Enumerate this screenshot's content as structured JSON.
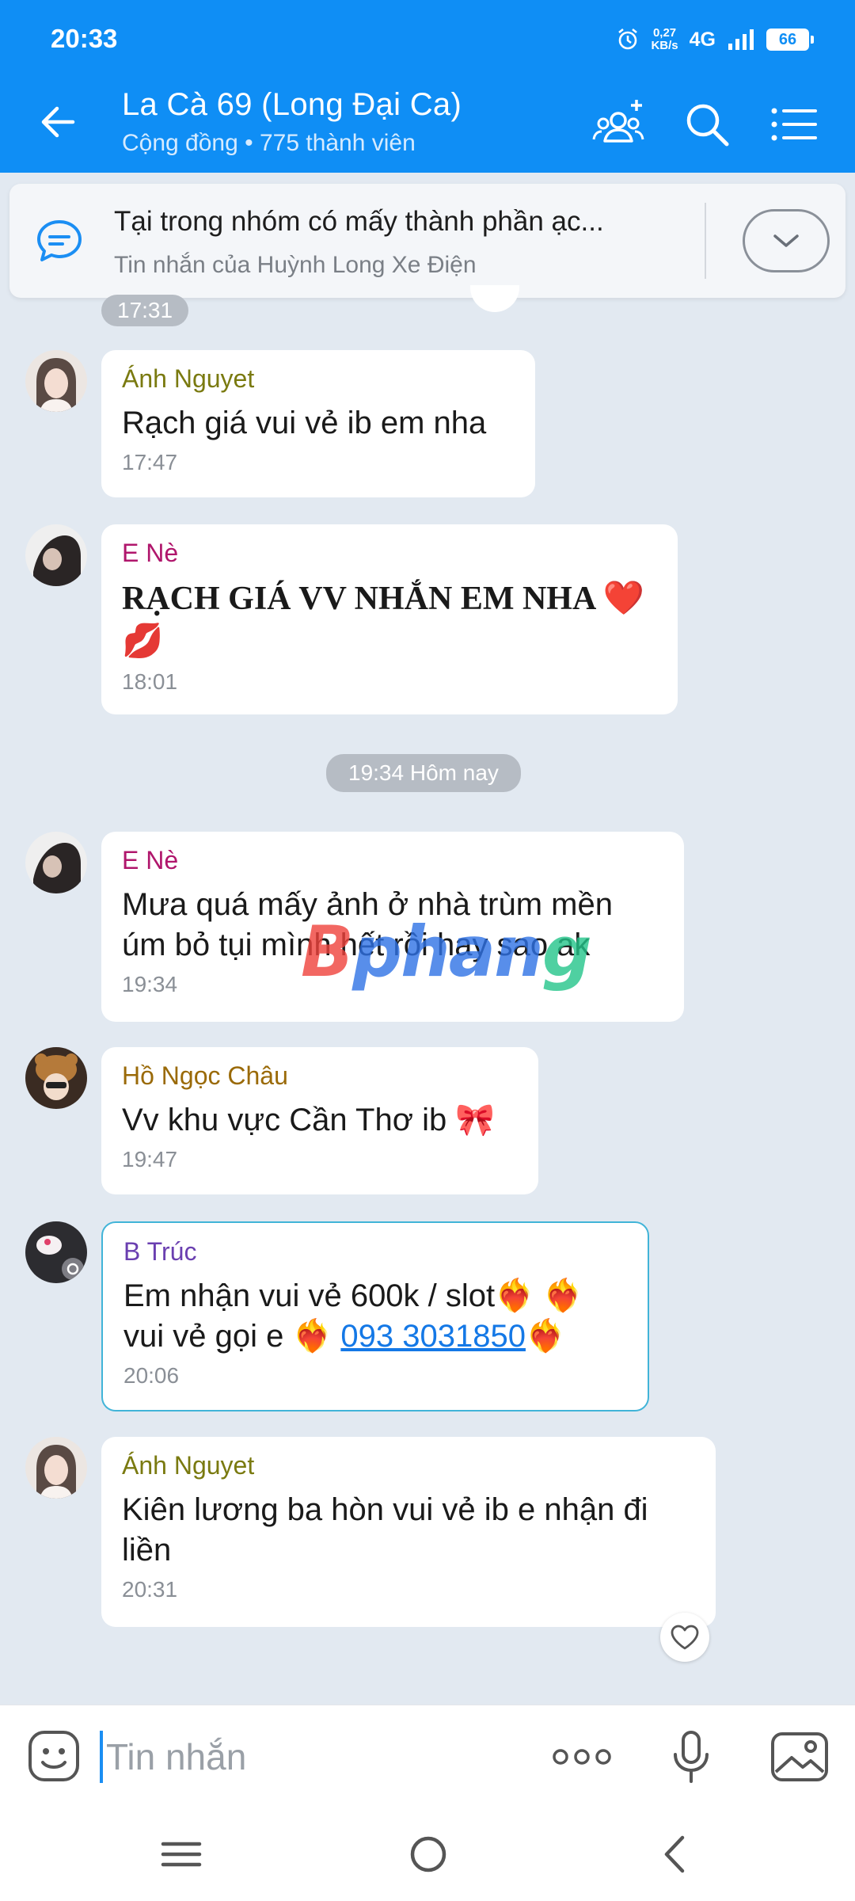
{
  "status": {
    "time": "20:33",
    "speed_top": "0,27",
    "speed_bottom": "KB/s",
    "network": "4G",
    "battery": "66"
  },
  "header": {
    "title": "La Cà 69 (Long Đại Ca)",
    "subtitle": "Cộng đồng • 775 thành viên"
  },
  "pinned": {
    "title": "Tại trong nhóm có mấy  thành phần ạc...",
    "subtitle": "Tin nhắn của Huỳnh Long Xe Điện"
  },
  "top_time": "17:31",
  "divider_time": "19:34 Hôm nay",
  "messages": [
    {
      "sender": "Ánh Nguyet",
      "sender_color": "#7a7a10",
      "text": "Rạch giá vui vẻ ib em nha",
      "time": "17:47"
    },
    {
      "sender": "E Nè",
      "sender_color": "#b0166c",
      "text": "RẠCH GIÁ VV NHẮN EM NHA ❤️ 💋",
      "time": "18:01"
    },
    {
      "sender": "E Nè",
      "sender_color": "#b0166c",
      "text": "Mưa quá mấy ảnh ở nhà trùm mền úm bỏ tụi mình hết rồi hay sao ak",
      "time": "19:34"
    },
    {
      "sender": "Hồ Ngọc Châu",
      "sender_color": "#9a6a08",
      "text": "Vv khu vực Cần Thơ ib 🎀",
      "time": "19:47"
    },
    {
      "sender": "B Trúc",
      "sender_color": "#6a3fb0",
      "text_a": "Em nhận vui vẻ 600k / slot❤️‍🔥 ❤️‍🔥",
      "text_b": "vui vẻ gọi e ❤️‍🔥 ",
      "phone": "093 3031850",
      "text_c": "❤️‍🔥",
      "time": "20:06"
    },
    {
      "sender": "Ánh Nguyet",
      "sender_color": "#7a7a10",
      "text": "Kiên lương ba hòn vui vẻ ib e nhận đi liền",
      "time": "20:31"
    }
  ],
  "watermark": {
    "a": "B",
    "b": "phan",
    "c": "g"
  },
  "input": {
    "placeholder": "Tin nhắn"
  }
}
